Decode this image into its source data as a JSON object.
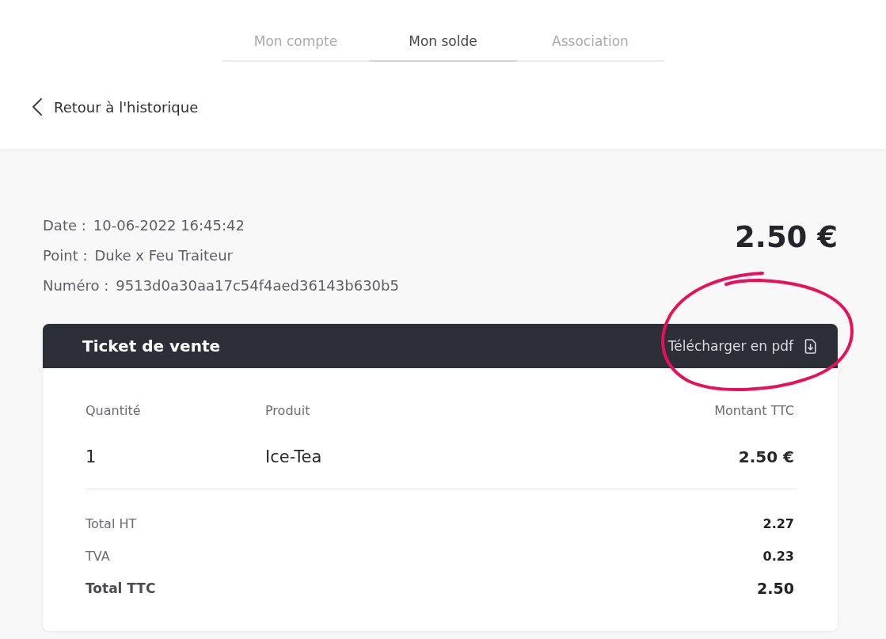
{
  "tabs": [
    {
      "label": "Mon compte",
      "selected": false
    },
    {
      "label": "Mon solde",
      "selected": true
    },
    {
      "label": "Association",
      "selected": false
    }
  ],
  "back_link": {
    "label": "Retour à l'historique"
  },
  "transaction": {
    "details": [
      {
        "label": "Date :",
        "value": "10-06-2022 16:45:42"
      },
      {
        "label": "Point :",
        "value": "Duke x Feu Traiteur"
      },
      {
        "label": "Numéro :",
        "value": "9513d0a30aa17c54f4aed36143b630b5"
      }
    ],
    "amount": "2.50 €"
  },
  "ticket": {
    "title": "Ticket de vente",
    "download": {
      "label": "Télécharger en pdf",
      "highlighted": true
    },
    "columns": [
      "Quantité",
      "Produit",
      "Montant TTC"
    ],
    "rows": [
      {
        "quantity": "1",
        "product": "Ice-Tea",
        "amount": "2.50 €"
      }
    ],
    "totals": [
      {
        "label": "Total HT",
        "value": "2.27",
        "emphasized": false
      },
      {
        "label": "TVA",
        "value": "0.23",
        "emphasized": false
      },
      {
        "label": "Total TTC",
        "value": "2.50",
        "emphasized": true
      }
    ]
  }
}
